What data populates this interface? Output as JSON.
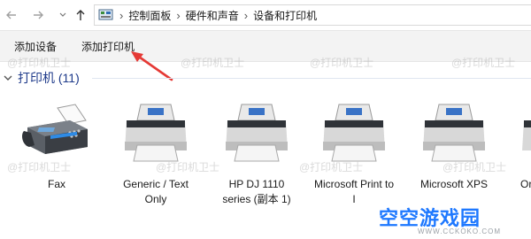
{
  "address_bar": {
    "back_icon": "back-arrow-icon",
    "forward_icon": "forward-arrow-icon",
    "dropdown_icon": "chevron-down-icon",
    "up_icon": "up-arrow-icon",
    "breadcrumbs": [
      "控制面板",
      "硬件和声音",
      "设备和打印机"
    ]
  },
  "command_bar": {
    "add_device_label": "添加设备",
    "add_printer_label": "添加打印机"
  },
  "group": {
    "title": "打印机 (11)",
    "accent_color": "#1e3a8a"
  },
  "devices": [
    {
      "label": "Fax",
      "icon": "fax-icon"
    },
    {
      "label": "Generic / Text Only",
      "icon": "printer-icon"
    },
    {
      "label": "HP DJ 1110 series (副本 1)",
      "icon": "printer-icon"
    },
    {
      "label": "Microsoft Print to I",
      "icon": "printer-icon"
    },
    {
      "label": "Microsoft XPS",
      "icon": "printer-icon"
    },
    {
      "label": "Or",
      "icon": "printer-icon"
    }
  ],
  "annotation": {
    "arrow_color": "#e53935"
  },
  "watermarks": {
    "text": "@打印机卫士",
    "logo_text": "空空游戏园",
    "logo_url": "WWW.CCKOKO.COM"
  }
}
